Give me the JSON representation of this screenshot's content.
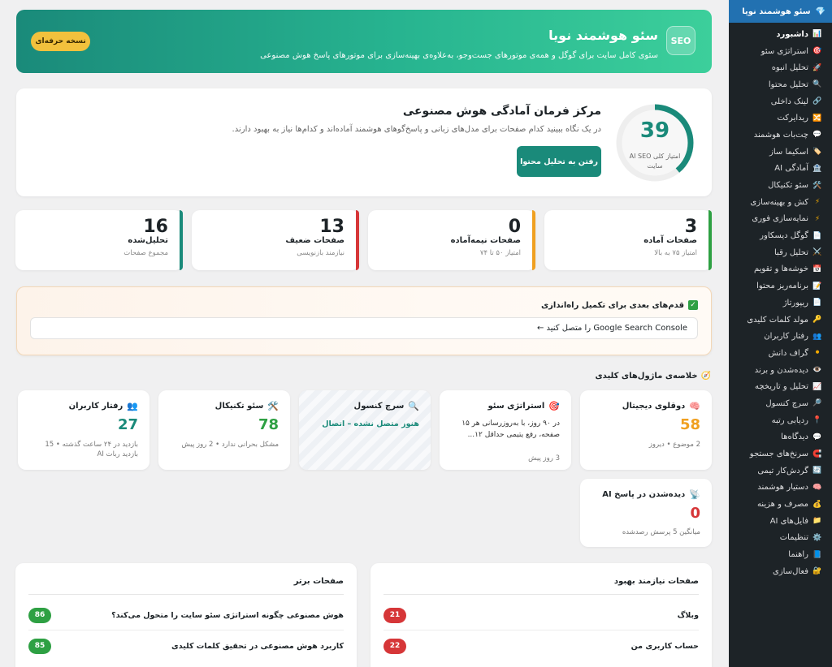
{
  "sidebar": {
    "header": "سئو هوشمند نویا",
    "items": [
      {
        "label": "داشبورد",
        "icon": "📊",
        "icon_name": "dashboard-icon",
        "active": true
      },
      {
        "label": "استراتژی سئو",
        "icon": "🎯",
        "icon_name": "target-icon"
      },
      {
        "label": "تحلیل انبوه",
        "icon": "🚀",
        "icon_name": "rocket-icon"
      },
      {
        "label": "تحلیل محتوا",
        "icon": "🔍",
        "icon_name": "search-icon"
      },
      {
        "label": "لینک داخلی",
        "icon": "🔗",
        "icon_name": "link-icon"
      },
      {
        "label": "ریدایرکت",
        "icon": "🔀",
        "icon_name": "redirect-icon"
      },
      {
        "label": "چت‌بات هوشمند",
        "icon": "💬",
        "icon_name": "chat-icon"
      },
      {
        "label": "اسکیما ساز",
        "icon": "🏷️",
        "icon_name": "tag-icon"
      },
      {
        "label": "آمادگی AI",
        "icon": "🏦",
        "icon_name": "building-icon"
      },
      {
        "label": "سئو تکنیکال",
        "icon": "🛠️",
        "icon_name": "tools-icon"
      },
      {
        "label": "کش و بهینه‌سازی",
        "icon": "⚡",
        "icon_name": "bolt-icon"
      },
      {
        "label": "نمایه‌سازی فوری",
        "icon": "⚡",
        "icon_name": "bolt-icon-2"
      },
      {
        "label": "گوگل دیسکاور",
        "icon": "📄",
        "icon_name": "page-icon"
      },
      {
        "label": "تحلیل رقبا",
        "icon": "⚔️",
        "icon_name": "swords-icon"
      },
      {
        "label": "خوشه‌ها و تقویم",
        "icon": "📅",
        "icon_name": "calendar-icon"
      },
      {
        "label": "برنامه‌ریز محتوا",
        "icon": "📝",
        "icon_name": "memo-icon"
      },
      {
        "label": "ریپورتاژ",
        "icon": "📄",
        "icon_name": "page-icon-2"
      },
      {
        "label": "مولد کلمات کلیدی",
        "icon": "🔑",
        "icon_name": "key-icon"
      },
      {
        "label": "رفتار کاربران",
        "icon": "👥",
        "icon_name": "users-icon"
      },
      {
        "label": "گراف دانش",
        "icon": "⚫",
        "icon_name": "graph-icon"
      },
      {
        "label": "دیده‌شدن و برند",
        "icon": "👁️",
        "icon_name": "eye-icon"
      },
      {
        "label": "تحلیل و تاریخچه",
        "icon": "📈",
        "icon_name": "chart-icon"
      },
      {
        "label": "سرچ کنسول",
        "icon": "🔎",
        "icon_name": "search-console-icon"
      },
      {
        "label": "ردیابی رتبه",
        "icon": "📍",
        "icon_name": "pin-icon"
      },
      {
        "label": "دیدگاه‌ها",
        "icon": "💬",
        "icon_name": "comments-icon"
      },
      {
        "label": "سرنخ‌های جستجو",
        "icon": "🧲",
        "icon_name": "magnet-icon"
      },
      {
        "label": "گردش‌کار تیمی",
        "icon": "🔄",
        "icon_name": "workflow-icon"
      },
      {
        "label": "دستیار هوشمند",
        "icon": "🧠",
        "icon_name": "brain-icon"
      },
      {
        "label": "مصرف و هزینه",
        "icon": "💰",
        "icon_name": "money-icon"
      },
      {
        "label": "فایل‌های AI",
        "icon": "📁",
        "icon_name": "folder-icon"
      },
      {
        "label": "تنظیمات",
        "icon": "⚙️",
        "icon_name": "gear-icon"
      },
      {
        "label": "راهنما",
        "icon": "📘",
        "icon_name": "book-icon"
      },
      {
        "label": "فعال‌سازی",
        "icon": "🔐",
        "icon_name": "lock-icon"
      }
    ]
  },
  "hero": {
    "badge": "SEO",
    "title": "سئو هوشمند نویا",
    "subtitle": "سئوی کامل سایت برای گوگل و همه‌ی موتورهای جست‌وجو، به‌علاوه‌ی بهینه‌سازی برای موتورهای پاسخ هوش مصنوعی",
    "pro_button": "نسخه حرفه‌ای"
  },
  "command": {
    "score": "39",
    "score_fraction": 0.39,
    "score_label": "امتیاز کلی AI SEO سایت",
    "title": "مرکز فرمان آمادگی هوش مصنوعی",
    "description": "در یک نگاه ببینید کدام صفحات برای مدل‌های زبانی و پاسخ‌گوهای هوشمند آماده‌اند و کدام‌ها نیاز به بهبود دارند.",
    "button": "رفتن به تحلیل محتوا"
  },
  "stats": [
    {
      "value": "3",
      "label": "صفحات آماده",
      "sub": "امتیاز ۷۵ به بالا",
      "color": "#2ea043"
    },
    {
      "value": "0",
      "label": "صفحات نیمه‌آماده",
      "sub": "امتیاز ۵۰ تا ۷۴",
      "color": "#f0a020"
    },
    {
      "value": "13",
      "label": "صفحات ضعیف",
      "sub": "نیازمند بازنویسی",
      "color": "#d63638"
    },
    {
      "value": "16",
      "label": "تحلیل‌شده",
      "sub": "مجموع صفحات",
      "color": "#1a8a7a"
    }
  ],
  "steps": {
    "title": "قدم‌های بعدی برای تکمیل راه‌اندازی",
    "item": "Google Search Console را متصل کنید ←"
  },
  "modules": {
    "title": "خلاصه‌ی ماژول‌های کلیدی",
    "digital_twin": {
      "title": "دوقلوی دیجیتال",
      "value": "58",
      "sub": "2 موضوع • دیروز",
      "color": "#f0a020"
    },
    "strategy": {
      "title": "استراتژی سئو",
      "text": "در ۹۰ روز، با به‌روزرسانی هر ۱۵ صفحه، رفع یتیمی حداقل ۱۲...",
      "meta": "3 روز پیش"
    },
    "search_console": {
      "title": "سرچ کنسول",
      "status": "هنوز متصل نشده – اتصال"
    },
    "technical": {
      "title": "سئو تکنیکال",
      "value": "78",
      "sub": "مشکل بحرانی ندارد • 2 روز پیش",
      "color": "#2ea043"
    },
    "behavior": {
      "title": "رفتار کاربران",
      "value": "27",
      "sub": "بازدید در ۲۴ ساعت گذشته • 15 بازدید ربات AI",
      "color": "#1a8a7a"
    },
    "ai_visibility": {
      "title": "دیده‌شدن در پاسخ AI",
      "value": "0",
      "sub": "میانگین 5 پرسش رصدشده",
      "color": "#d63638"
    }
  },
  "needs_improvement": {
    "title": "صفحات نیازمند بهبود",
    "rows": [
      {
        "label": "وبلاگ",
        "score": "21"
      },
      {
        "label": "حساب کاربری من",
        "score": "22"
      }
    ]
  },
  "top_pages": {
    "title": "صفحات برتر",
    "rows": [
      {
        "label": "هوش مصنوعی چگونه استراتژی سئو سایت را متحول می‌کند؟",
        "score": "86"
      },
      {
        "label": "کاربرد هوش مصنوعی در تحقیق کلمات کلیدی",
        "score": "85"
      }
    ]
  },
  "colors": {
    "accent": "#1a8a7a",
    "sidebar_bg": "#1d2327",
    "sidebar_head": "#2271b1",
    "pro": "#f2c13d"
  }
}
